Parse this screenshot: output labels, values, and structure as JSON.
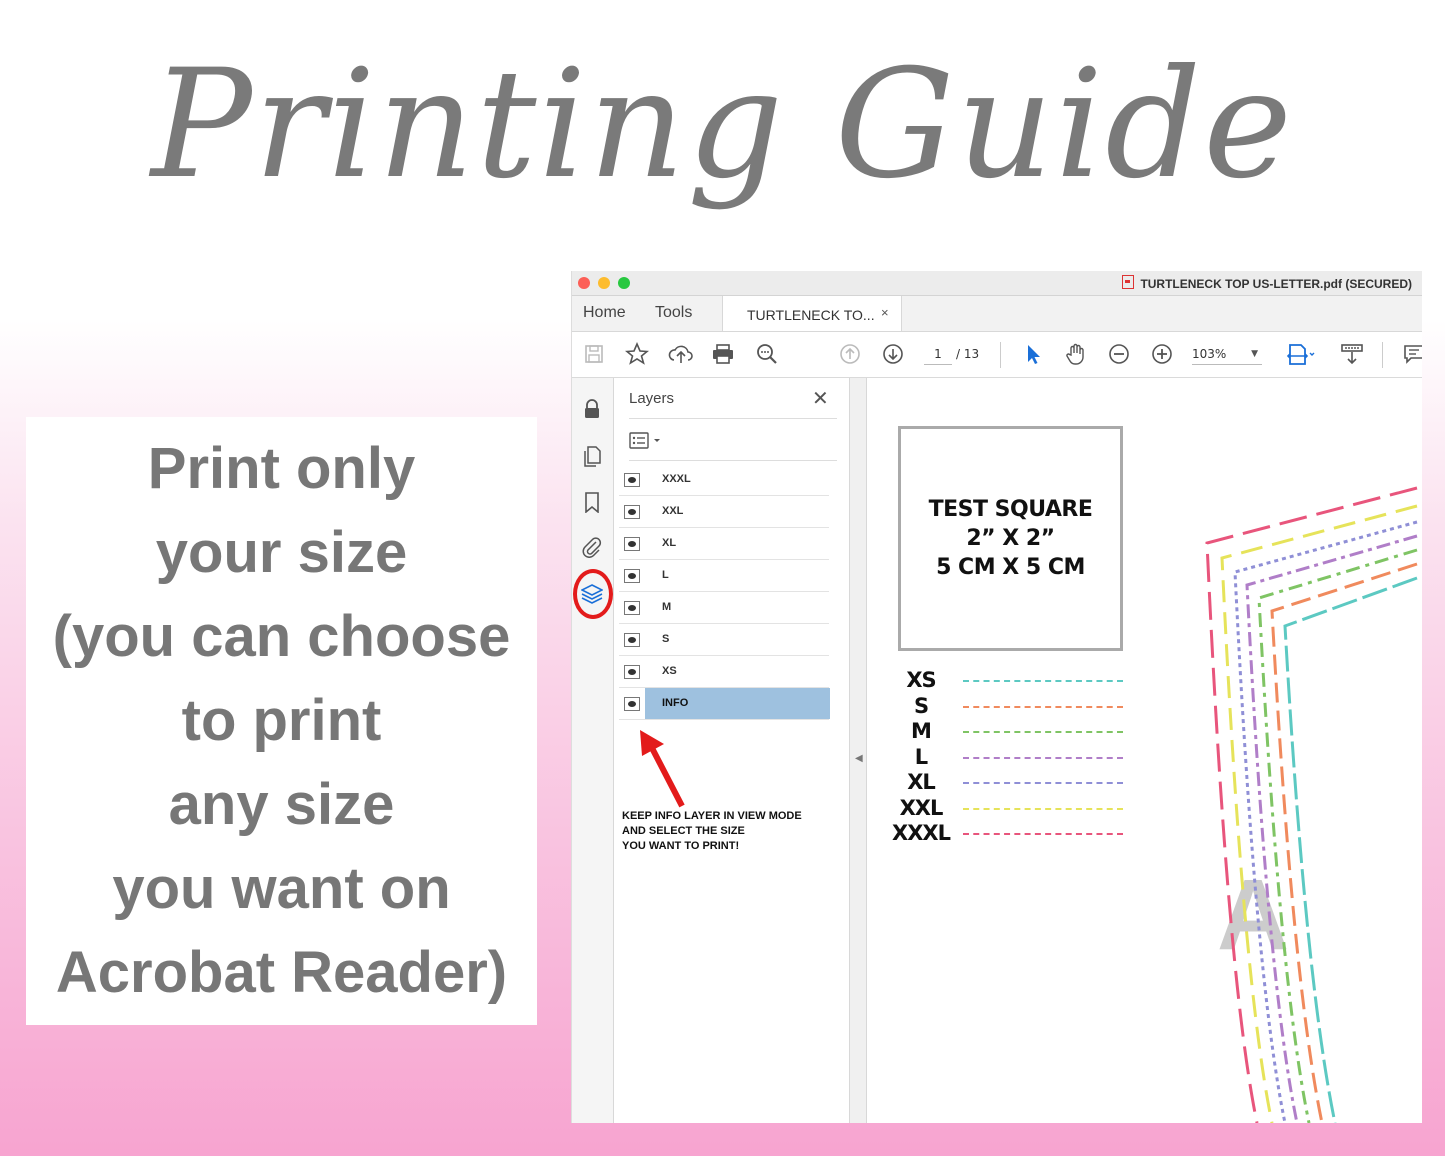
{
  "title": "Printing Guide",
  "note": {
    "text": "Print only\nyour size\n(you can choose\nto print\nany size\nyou want on\nAcrobat Reader)"
  },
  "window": {
    "title": "TURTLENECK TOP  US-LETTER.pdf (SECURED)",
    "nav_tabs": [
      "Home",
      "Tools"
    ],
    "doc_tab": "TURTLENECK TO...",
    "doc_tab_close": "×"
  },
  "toolbar": {
    "page_current": "1",
    "page_total": "/ 13",
    "zoom": "103%",
    "icons": [
      "save-icon",
      "star-icon",
      "upload-icon",
      "print-icon",
      "search-icon",
      "page-up-icon",
      "page-down-icon",
      "select-arrow-icon",
      "hand-icon",
      "zoom-out-icon",
      "zoom-in-icon",
      "fit-page-icon",
      "scroll-mode-icon",
      "comment-icon"
    ]
  },
  "rail": {
    "icons": [
      "lock-icon",
      "pages-icon",
      "bookmark-icon",
      "attachment-icon",
      "layers-icon"
    ]
  },
  "panel": {
    "title": "Layers",
    "close": "✕",
    "layers": [
      {
        "name": "XXXL",
        "selected": false
      },
      {
        "name": "XXL",
        "selected": false
      },
      {
        "name": "XL",
        "selected": false
      },
      {
        "name": "L",
        "selected": false
      },
      {
        "name": "M",
        "selected": false
      },
      {
        "name": "S",
        "selected": false
      },
      {
        "name": "XS",
        "selected": false
      },
      {
        "name": "INFO",
        "selected": true
      }
    ],
    "note": "KEEP INFO LAYER IN VIEW MODE\nAND SELECT THE SIZE\nYOU WANT TO PRINT!"
  },
  "document": {
    "test_square": "TEST SQUARE\n2” X 2”\n5 CM X 5 CM",
    "sizes": [
      {
        "label": "XS",
        "color": "#5cc9c2"
      },
      {
        "label": "S",
        "color": "#f08a5d"
      },
      {
        "label": "M",
        "color": "#7fc464"
      },
      {
        "label": "L",
        "color": "#b07ec8"
      },
      {
        "label": "XL",
        "color": "#8f8fd6"
      },
      {
        "label": "XXL",
        "color": "#e6e35a"
      },
      {
        "label": "XXXL",
        "color": "#e8557c"
      }
    ],
    "watermark": "A"
  },
  "colors": {
    "highlight_ring": "#e31b1b",
    "arrow": "#e31b1b",
    "selected_row": "#9ec1df",
    "title_gray": "#7a7a7a"
  }
}
